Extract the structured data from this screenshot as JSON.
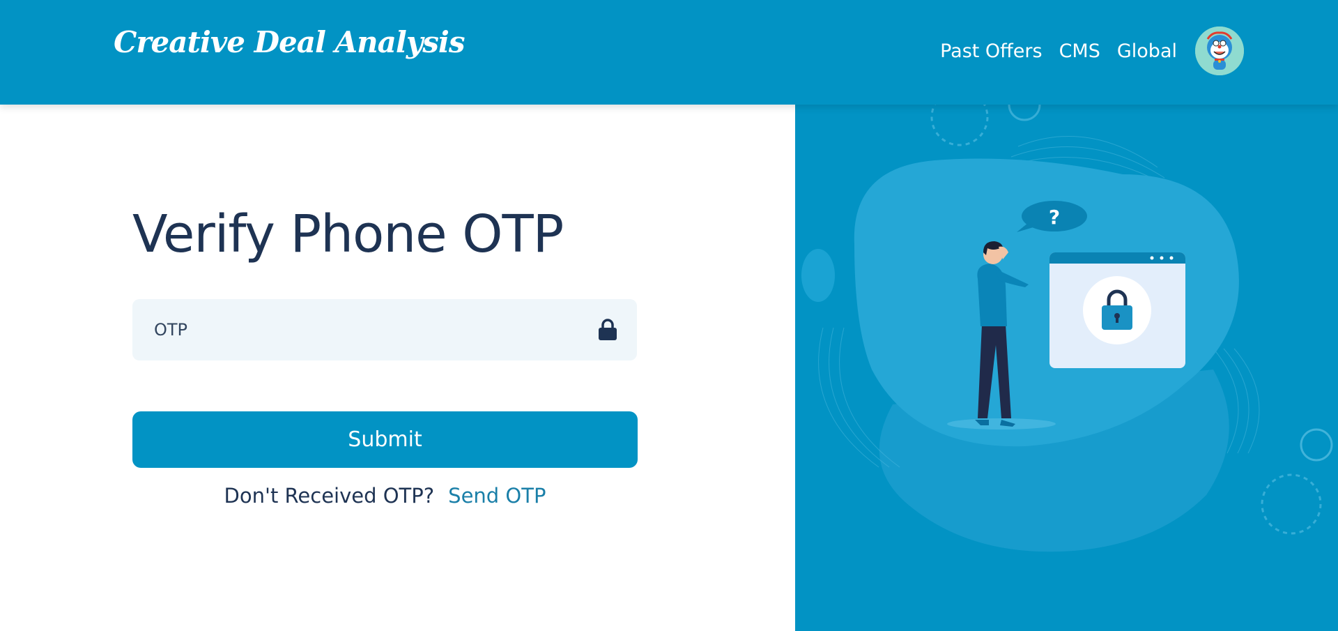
{
  "header": {
    "brand": "Creative Deal Analysis",
    "nav": [
      {
        "label": "Past Offers"
      },
      {
        "label": "CMS"
      },
      {
        "label": "Global"
      }
    ]
  },
  "form": {
    "title": "Verify Phone OTP",
    "otp_placeholder": "OTP",
    "otp_value": "",
    "submit_label": "Submit",
    "resend_prompt": "Don't Received OTP?",
    "resend_link": "Send OTP"
  },
  "illustration": {
    "bubble_text": "?"
  },
  "colors": {
    "brand": "#0293c4",
    "heading": "#1e3353",
    "link": "#1a7fa8",
    "input_bg": "#eff6fa"
  },
  "icons": {
    "field": "lock-icon",
    "avatar": "avatar-image"
  }
}
